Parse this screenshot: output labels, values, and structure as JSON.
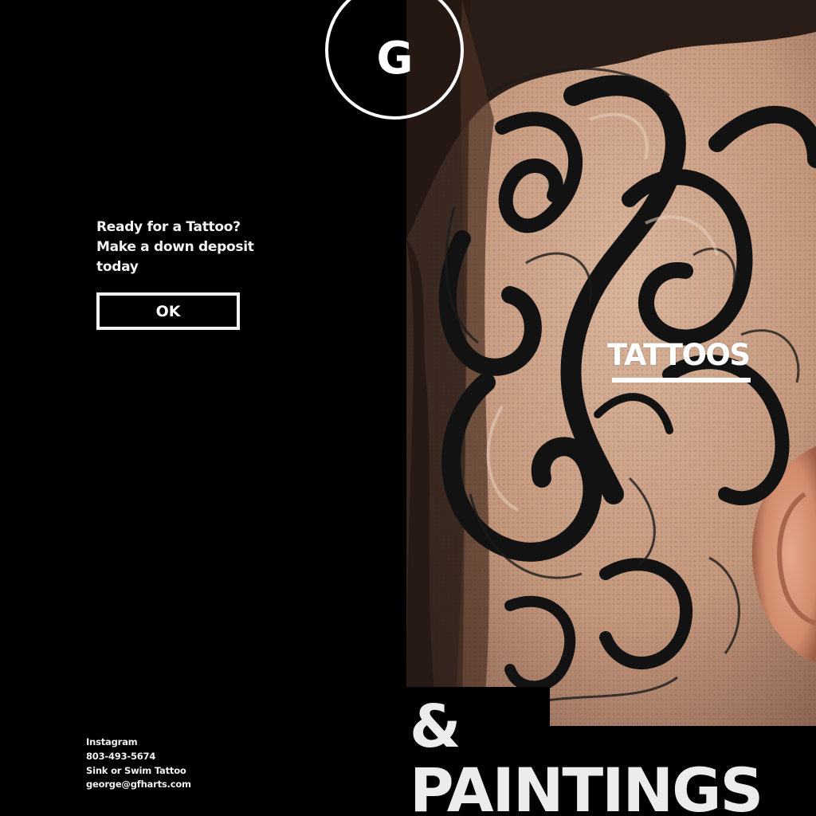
{
  "logo": {
    "letter": "G"
  },
  "promo": {
    "line1": "Ready for a Tattoo?",
    "line2": "Make a down deposit",
    "line3": "today",
    "button_label": "OK"
  },
  "nav": {
    "tattoos_label": "TATTOOS"
  },
  "headline": {
    "amp": "&",
    "word": "PAINTINGS"
  },
  "contact": {
    "instagram": "Instagram",
    "phone": "803-493-5674",
    "studio": "Sink or Swim Tattoo",
    "email": "george@gfharts.com"
  },
  "photo": {
    "icon": "tattoo-photo"
  },
  "colors": {
    "background": "#000000",
    "text": "#ffffff",
    "skin": "#c79a80",
    "ink": "#151515"
  }
}
